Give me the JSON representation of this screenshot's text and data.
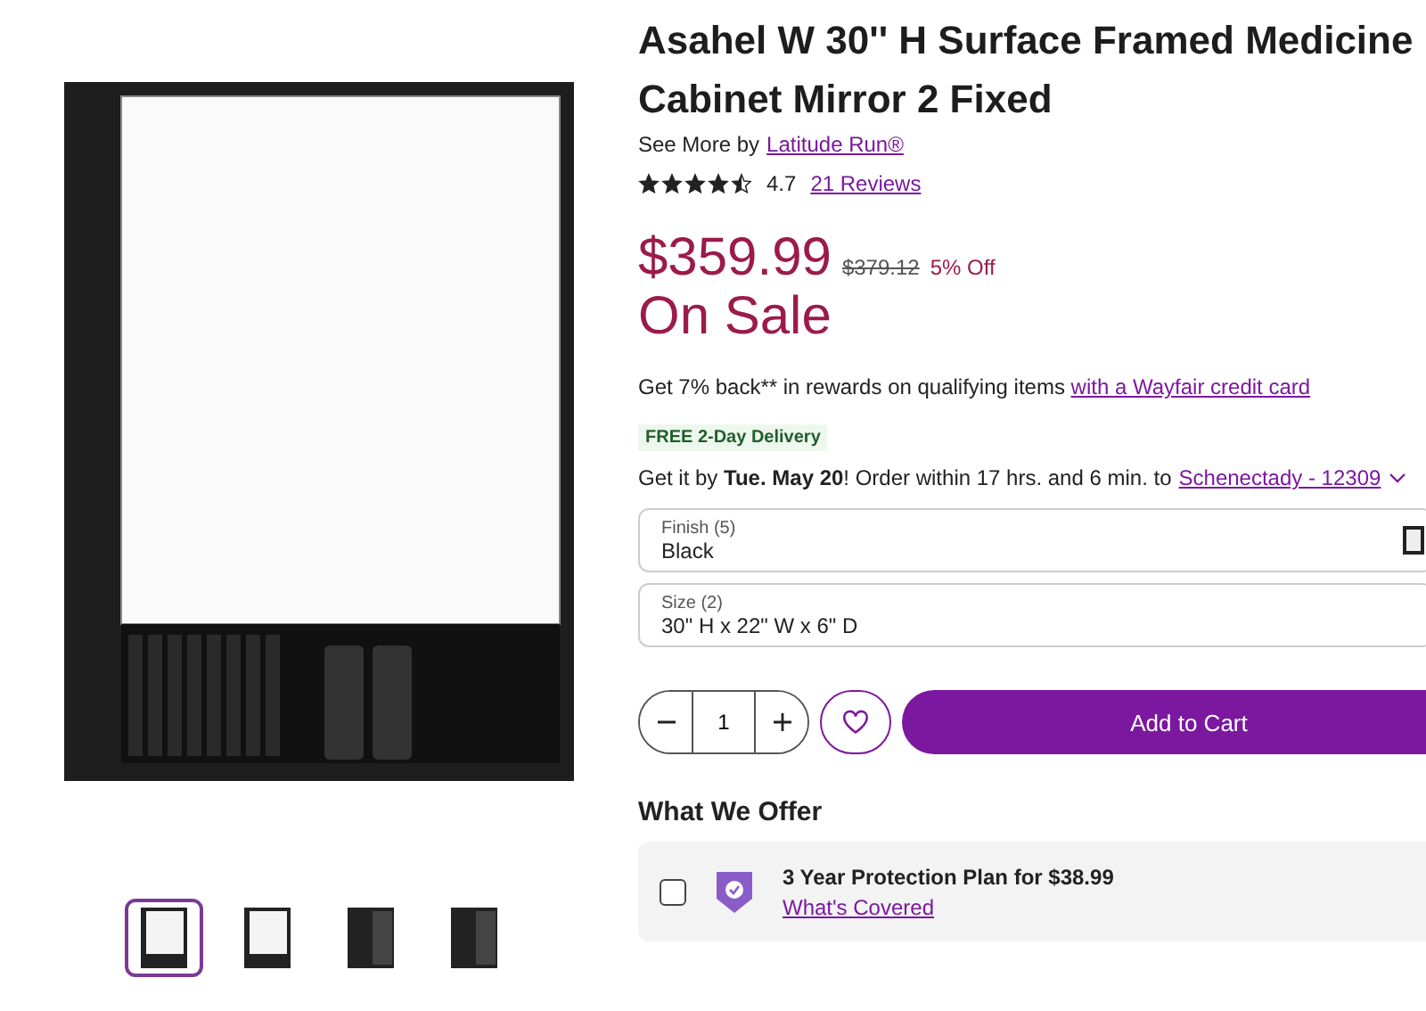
{
  "gallery": {
    "thumbnails": [
      {
        "selected": true
      },
      {
        "selected": false
      },
      {
        "selected": false
      },
      {
        "selected": false
      }
    ]
  },
  "product": {
    "title": "Asahel W 30'' H Surface Framed Medicine Cabinet Mirror 2 Fixed",
    "brand_prefix": "See More by",
    "brand": "Latitude Run®",
    "stars": 4.5,
    "rating": "4.7",
    "reviews": "21 Reviews"
  },
  "price": {
    "current": "$359.99",
    "original": "$379.12",
    "discount": "5% Off",
    "sale_label": "On Sale"
  },
  "rewards": {
    "text": "Get 7% back** in rewards on qualifying items",
    "link": "with a Wayfair credit card"
  },
  "delivery": {
    "badge": "FREE 2-Day Delivery",
    "text": "Get it by **Tue. May 20**! Order within 17 hrs. and 6 min. to",
    "location": "Schenectady - 12309"
  },
  "options": [
    {
      "label": "Finish (5)",
      "value": "Black",
      "swatch": true
    },
    {
      "label": "Size (2)",
      "value": "30\" H x 22\" W x 6\" D",
      "swatch": false
    }
  ],
  "cart": {
    "quantity": "1",
    "favorite": false,
    "button": "Add to Cart"
  },
  "offers": {
    "heading": "What We Offer",
    "items": [
      {
        "checked": false,
        "title": "3 Year Protection Plan for $38.99",
        "link": "What's Covered"
      }
    ]
  }
}
